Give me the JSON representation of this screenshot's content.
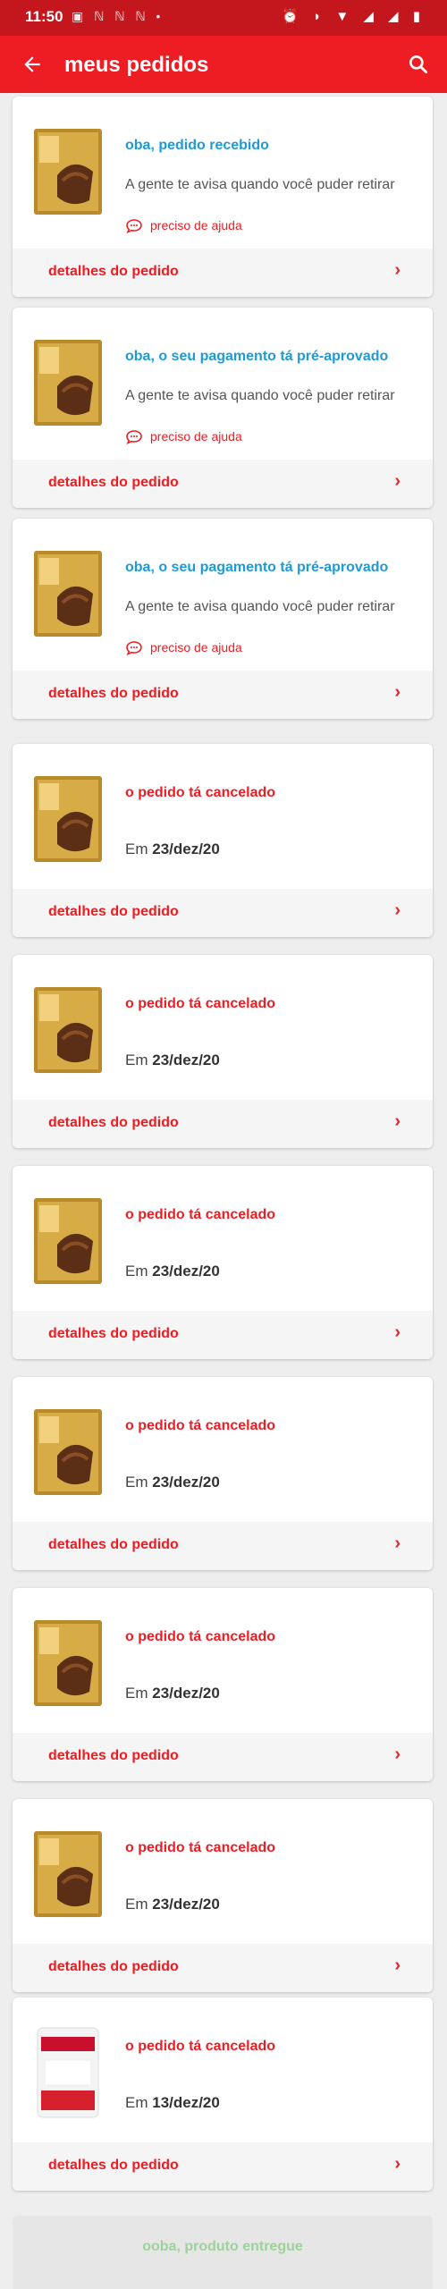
{
  "status_bar": {
    "time": "11:50",
    "notifications": "▣ ℕ ℕ ℕ •",
    "system": "⏰ ◗ ▼ ◢ ◢ ▮"
  },
  "app_bar": {
    "title": "meus pedidos",
    "back_icon": "arrow-left-icon",
    "search_icon": "search-icon"
  },
  "colors": {
    "primary": "#ee1d23",
    "status_bar": "#c4161d",
    "ok_status": "#1e9bd7",
    "delivered": "#9dd29b"
  },
  "orders": [
    {
      "status": "oba, pedido recebido",
      "type": "ok",
      "message": "A gente te avisa quando você puder retirar",
      "help": "preciso de ajuda",
      "date_prefix": "",
      "date": "",
      "footer": "detalhes do pedido",
      "product": "chocolate-box"
    },
    {
      "status": "oba, o seu pagamento tá pré-aprovado",
      "type": "ok",
      "message": "A gente te avisa quando você puder retirar",
      "help": "preciso de ajuda",
      "date_prefix": "",
      "date": "",
      "footer": "detalhes do pedido",
      "product": "chocolate-box"
    },
    {
      "status": "oba, o seu pagamento tá pré-aprovado",
      "type": "ok",
      "message": "A gente te avisa quando você puder retirar",
      "help": "preciso de ajuda",
      "date_prefix": "",
      "date": "",
      "footer": "detalhes do pedido",
      "product": "chocolate-box"
    },
    {
      "status": "o pedido tá cancelado",
      "type": "cancel",
      "message": "",
      "help": "",
      "date_prefix": "Em ",
      "date": "23/dez/20",
      "footer": "detalhes do pedido",
      "product": "chocolate-box"
    },
    {
      "status": "o pedido tá cancelado",
      "type": "cancel",
      "message": "",
      "help": "",
      "date_prefix": "Em ",
      "date": "23/dez/20",
      "footer": "detalhes do pedido",
      "product": "chocolate-box"
    },
    {
      "status": "o pedido tá cancelado",
      "type": "cancel",
      "message": "",
      "help": "",
      "date_prefix": "Em ",
      "date": "23/dez/20",
      "footer": "detalhes do pedido",
      "product": "chocolate-box"
    },
    {
      "status": "o pedido tá cancelado",
      "type": "cancel",
      "message": "",
      "help": "",
      "date_prefix": "Em ",
      "date": "23/dez/20",
      "footer": "detalhes do pedido",
      "product": "chocolate-box"
    },
    {
      "status": "o pedido tá cancelado",
      "type": "cancel",
      "message": "",
      "help": "",
      "date_prefix": "Em ",
      "date": "23/dez/20",
      "footer": "detalhes do pedido",
      "product": "chocolate-box"
    },
    {
      "status": "o pedido tá cancelado",
      "type": "cancel",
      "message": "",
      "help": "",
      "date_prefix": "Em ",
      "date": "23/dez/20",
      "footer": "detalhes do pedido",
      "product": "chocolate-box"
    },
    {
      "status": "o pedido tá cancelado",
      "type": "cancel",
      "message": "",
      "help": "",
      "date_prefix": "Em ",
      "date": "13/dez/20",
      "footer": "detalhes do pedido",
      "product": "milk-powder-bag"
    }
  ],
  "last_card": {
    "label": "ooba, produto entregue"
  }
}
